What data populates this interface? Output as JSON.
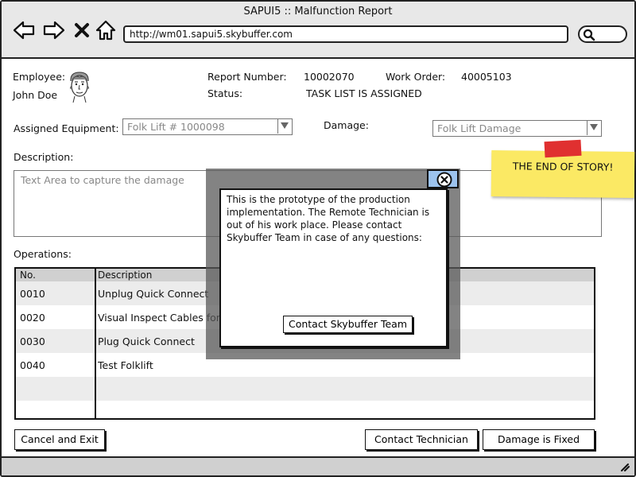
{
  "window": {
    "title": "SAPUI5 :: Malfunction Report",
    "url": "http://wm01.sapui5.skybuffer.com"
  },
  "nav_icons": [
    "back-arrow-icon",
    "forward-arrow-icon",
    "close-x-icon",
    "home-icon",
    "search-icon"
  ],
  "employee": {
    "label": "Employee:",
    "name": "John Doe",
    "avatar_icon": "person-face-icon"
  },
  "report": {
    "number_label": "Report Number:",
    "number_value": "10002070",
    "work_order_label": "Work Order:",
    "work_order_value": "40005103",
    "status_label": "Status:",
    "status_value": "TASK LIST IS ASSIGNED"
  },
  "equipment": {
    "label": "Assigned Equipment:",
    "value": "Folk Lift # 1000098"
  },
  "damage": {
    "label": "Damage:",
    "value": "Folk Lift Damage"
  },
  "description": {
    "label": "Description:",
    "placeholder": "Text Area to capture the damage"
  },
  "operations": {
    "label": "Operations:",
    "columns": [
      "No.",
      "Description"
    ],
    "rows": [
      {
        "no": "0010",
        "desc": "Unplug Quick Connect"
      },
      {
        "no": "0020",
        "desc": "Visual Inspect Cables for"
      },
      {
        "no": "0030",
        "desc": "Plug Quick Connect"
      },
      {
        "no": "0040",
        "desc": "Test Folklift"
      },
      {
        "no": "",
        "desc": ""
      }
    ]
  },
  "buttons": {
    "cancel": "Cancel and Exit",
    "contact_technician": "Contact Technician",
    "damage_fixed": "Damage is Fixed"
  },
  "modal": {
    "text": "This is the prototype of the production implementation. The Remote Technician is out of his work place. Please contact Skybuffer Team in case of any questions:",
    "button": "Contact Skybuffer Team"
  },
  "sticky_note": {
    "text": "THE END OF STORY!"
  },
  "colors": {
    "chrome_gray": "#e8e8e8",
    "table_header": "#d0d0d0",
    "row_alt": "#ececec",
    "close_button": "#9cc3ee",
    "sticky_yellow": "#fbe964",
    "sticky_tape": "#e03030"
  }
}
